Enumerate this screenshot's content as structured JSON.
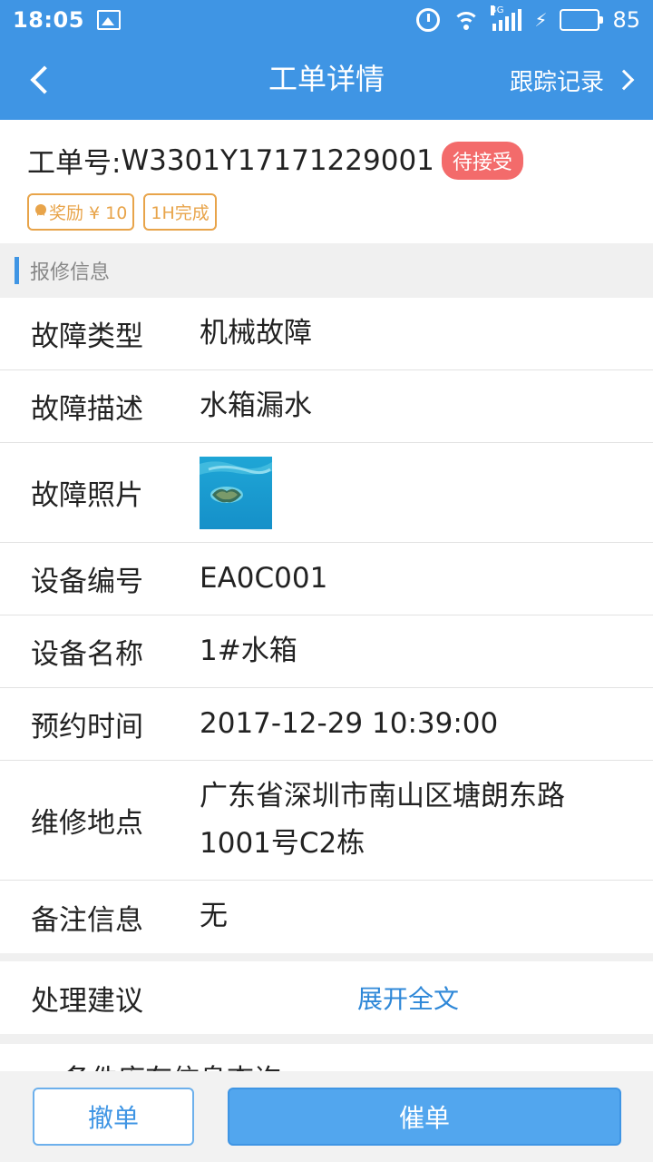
{
  "status_bar": {
    "time": "18:05",
    "network": "4G",
    "battery": "85"
  },
  "nav": {
    "title": "工单详情",
    "track_label": "跟踪记录"
  },
  "order": {
    "label": "工单号:",
    "number": "W3301Y17171229001",
    "status": "待接受",
    "reward_tag": "奖励 ¥ 10",
    "time_tag": "1H完成"
  },
  "section": {
    "title": "报修信息"
  },
  "info": {
    "fault_type": {
      "label": "故障类型",
      "value": "机械故障"
    },
    "fault_desc": {
      "label": "故障描述",
      "value": "水箱漏水"
    },
    "fault_photo": {
      "label": "故障照片"
    },
    "device_code": {
      "label": "设备编号",
      "value": "EA0C001"
    },
    "device_name": {
      "label": "设备名称",
      "value": "1#水箱"
    },
    "appointment": {
      "label": "预约时间",
      "value": "2017-12-29 10:39:00"
    },
    "location": {
      "label": "维修地点",
      "value": "广东省深圳市南山区塘朗东路1001号C2栋"
    },
    "remark": {
      "label": "备注信息",
      "value": "无"
    }
  },
  "suggestion": {
    "label": "处理建议",
    "expand": "展开全文"
  },
  "partial_section": {
    "title": "备件库存信息查询"
  },
  "actions": {
    "cancel": "撤单",
    "urge": "催单"
  },
  "colors": {
    "primary": "#3f95e4",
    "badge": "#f36b6b",
    "tag": "#e8a44a"
  }
}
